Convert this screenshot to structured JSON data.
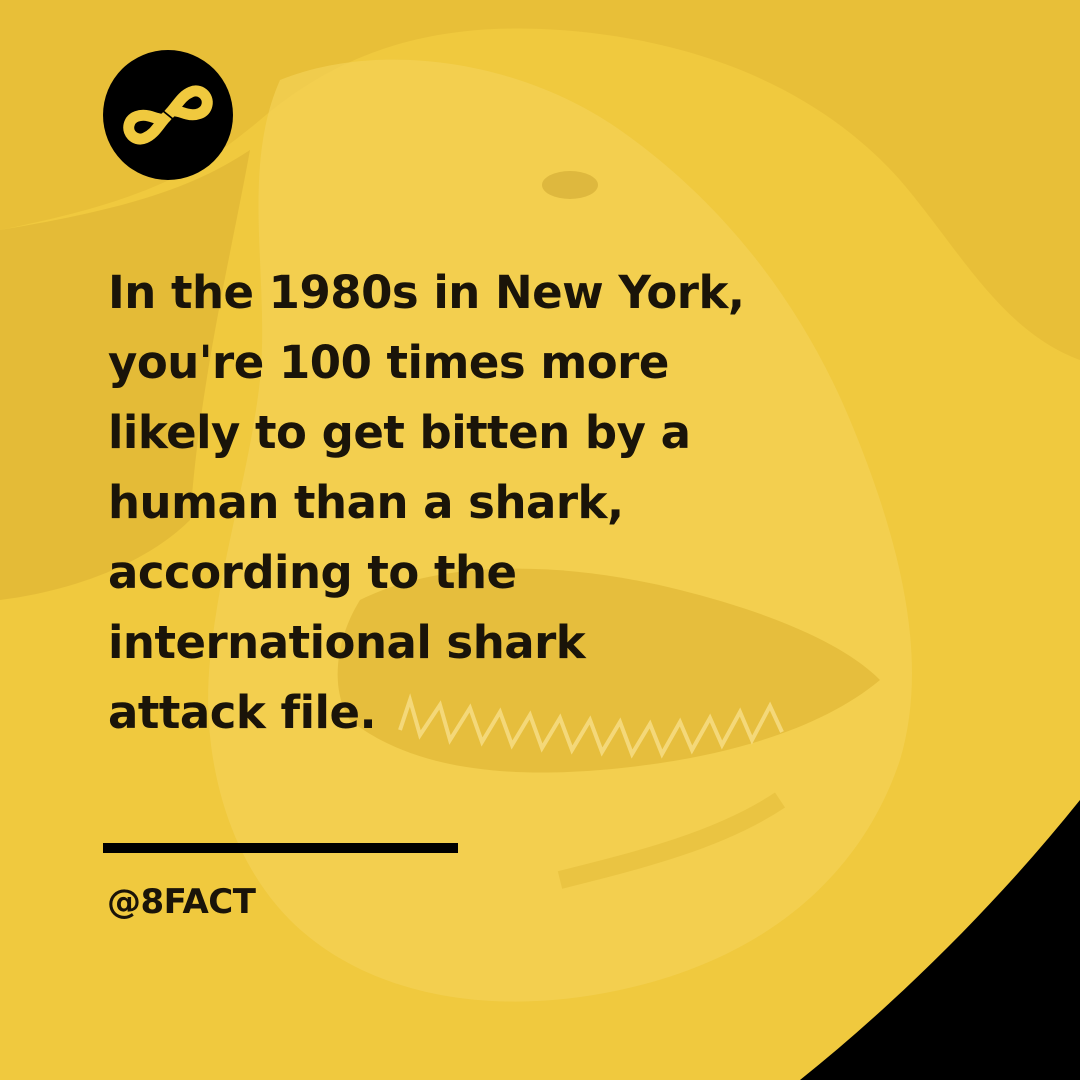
{
  "post": {
    "fact_text": "In the 1980s in New York,\nyou're 100 times more\nlikely to get bitten by a\nhuman than a shark,\naccording to the\ninternational shark\nattack file.",
    "handle": "@8FACT"
  },
  "brand": {
    "logo_icon": "infinity-eight-logo-icon",
    "background_color": "#f0c93e",
    "text_color": "#1a1409",
    "accent_color": "#000000"
  },
  "background": {
    "image_subject": "shark-jaws-photo"
  }
}
